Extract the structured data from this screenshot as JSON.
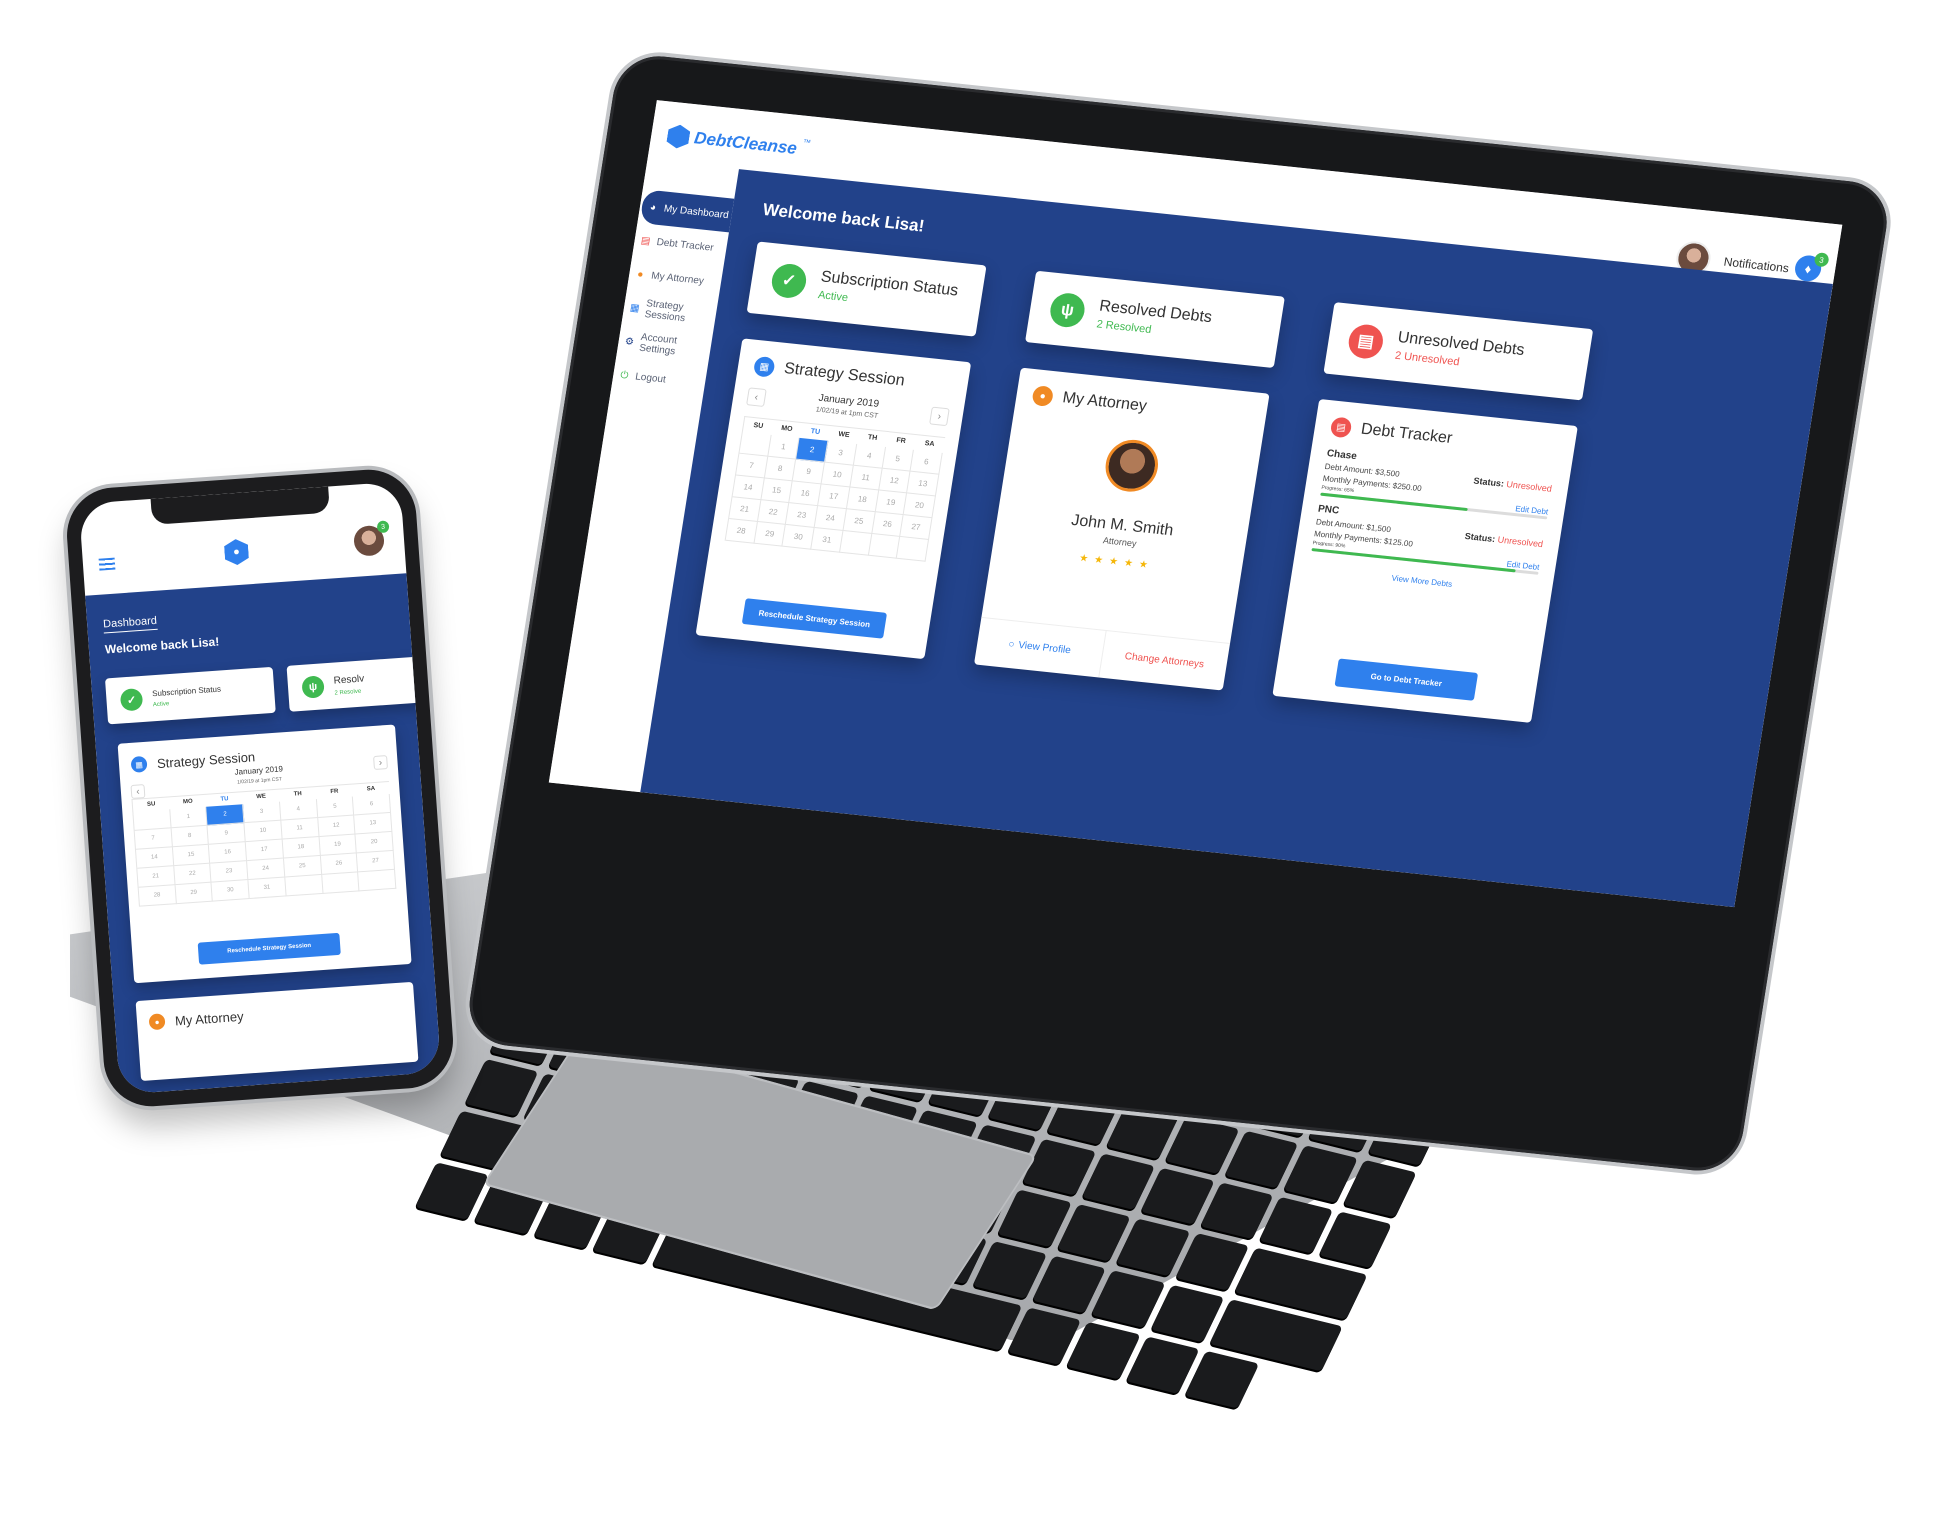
{
  "app": {
    "brand": "DebtCleanse",
    "brand_tm": "™"
  },
  "header": {
    "notifications_label": "Notifications",
    "notifications_count": "3"
  },
  "sidebar": {
    "items": [
      {
        "label": "My Dashboard",
        "icon": "dashboard-icon",
        "active": true
      },
      {
        "label": "Debt Tracker",
        "icon": "chart-icon",
        "active": false
      },
      {
        "label": "My Attorney",
        "icon": "person-icon",
        "active": false
      },
      {
        "label": "Strategy Sessions",
        "icon": "calendar-icon",
        "active": false
      },
      {
        "label": "Account Settings",
        "icon": "gear-icon",
        "active": false
      },
      {
        "label": "Logout",
        "icon": "power-icon",
        "active": false
      }
    ]
  },
  "main": {
    "welcome": "Welcome back Lisa!",
    "subscription": {
      "title": "Subscription Status",
      "value": "Active"
    },
    "resolved": {
      "title": "Resolved Debts",
      "value": "2 Resolved"
    },
    "unresolved": {
      "title": "Unresolved Debts",
      "value": "2 Unresolved"
    },
    "strategy": {
      "title": "Strategy Session",
      "month": "January 2019",
      "time": "1/02/19 at 1pm CST",
      "time_mobile": "1/02/19 at 1pm CST",
      "days_of_week": [
        "SU",
        "MO",
        "TU",
        "WE",
        "TH",
        "FR",
        "SA"
      ],
      "weeks": [
        [
          "",
          "1",
          "2",
          "3",
          "4",
          "5",
          "6"
        ],
        [
          "7",
          "8",
          "9",
          "10",
          "11",
          "12",
          "13"
        ],
        [
          "14",
          "15",
          "16",
          "17",
          "18",
          "19",
          "20"
        ],
        [
          "21",
          "22",
          "23",
          "24",
          "25",
          "26",
          "27"
        ],
        [
          "28",
          "29",
          "30",
          "31",
          "",
          "",
          ""
        ]
      ],
      "selected_day": "2",
      "button": "Reschedule Strategy Session"
    },
    "attorney": {
      "title": "My Attorney",
      "name": "John M. Smith",
      "role": "Attorney",
      "rating": 5,
      "view_profile": "View Profile",
      "change": "Change Attorneys"
    },
    "debt_tracker": {
      "title": "Debt Tracker",
      "debts": [
        {
          "name": "Chase",
          "amount": "Debt Amount: $3,500",
          "monthly": "Monthly Payments: $250.00",
          "progress_label": "Progress: 65%",
          "progress": 65,
          "status_label": "Status:",
          "status": "Unresolved",
          "edit": "Edit Debt"
        },
        {
          "name": "PNC",
          "amount": "Debt Amount: $1,500",
          "monthly": "Monthly Payments: $125.00",
          "progress_label": "Progress: 90%",
          "progress": 90,
          "status_label": "Status:",
          "status": "Unresolved",
          "edit": "Edit Debt"
        }
      ],
      "view_more": "View More Debts",
      "button": "Go to Debt Tracker"
    }
  },
  "mobile": {
    "breadcrumb": "Dashboard",
    "welcome": "Welcome back Lisa!",
    "subscription_title": "Subscription Status",
    "subscription_value": "Active",
    "resolved_title": "Resolv",
    "resolved_value": "2 Resolve",
    "attorney_title": "My Attorney",
    "notifications_count": "3"
  },
  "colors": {
    "primary": "#2f80ed",
    "navy": "#22428a",
    "green": "#3fb950",
    "red": "#ef5350",
    "orange": "#f08a24"
  }
}
